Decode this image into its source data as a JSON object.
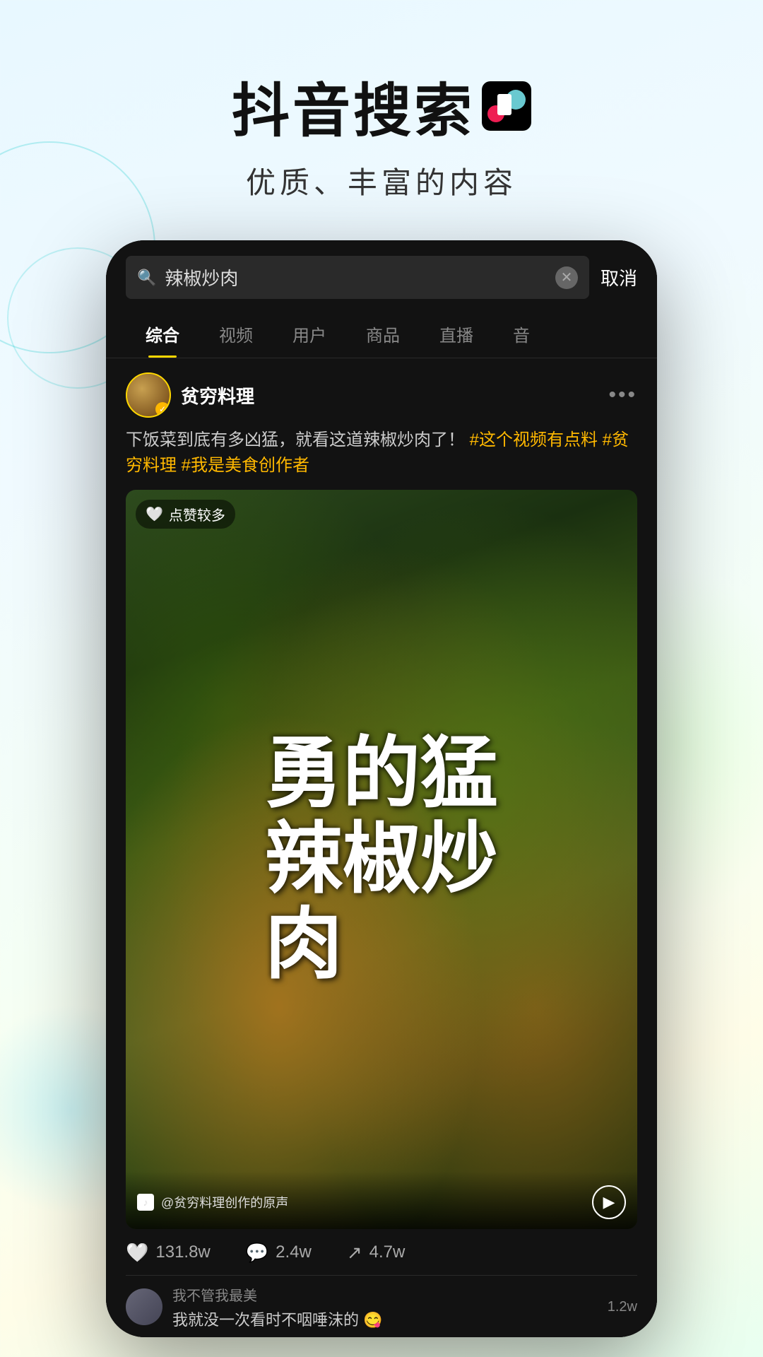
{
  "header": {
    "title": "抖音搜索",
    "subtitle": "优质、丰富的内容"
  },
  "search": {
    "query": "辣椒炒肉",
    "cancel_label": "取消",
    "placeholder": "辣椒炒肉"
  },
  "tabs": [
    {
      "label": "综合",
      "active": true
    },
    {
      "label": "视频",
      "active": false
    },
    {
      "label": "用户",
      "active": false
    },
    {
      "label": "商品",
      "active": false
    },
    {
      "label": "直播",
      "active": false
    },
    {
      "label": "音",
      "active": false
    }
  ],
  "post": {
    "author": "贫穷料理",
    "description": "下饭菜到底有多凶猛，就看这道辣椒炒肉了！",
    "hashtags": "#这个视频有点料 #贫穷料理 #我是美食创作者",
    "likes_badge": "点赞较多",
    "video_text": "勇的猛辣椒炒肉",
    "audio_label": "@贫穷料理创作的原声",
    "stats": {
      "likes": "131.8w",
      "comments": "2.4w",
      "shares": "4.7w"
    }
  },
  "comments": [
    {
      "author": "我不管我最美",
      "text": "我就没一次看时不咽唾沫的 😋",
      "likes": "1.2w"
    }
  ]
}
